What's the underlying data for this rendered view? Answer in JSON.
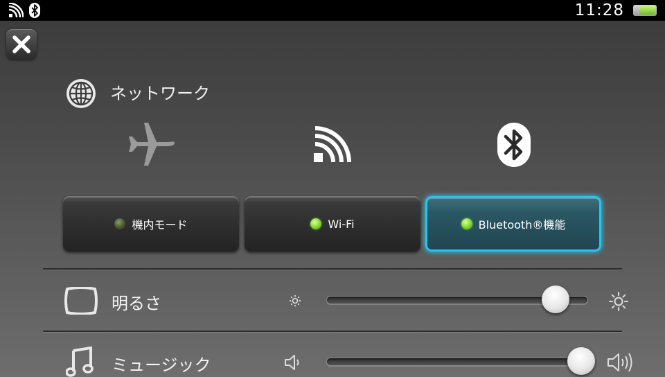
{
  "status_bar": {
    "time": "11:28",
    "battery_level": 0.75,
    "icons": [
      "wifi-icon",
      "bluetooth-icon"
    ]
  },
  "close_button": {
    "icon": "close-icon"
  },
  "network": {
    "title": "ネットワーク",
    "icon": "globe-icon",
    "toggles": [
      {
        "label": "機内モード",
        "icon": "airplane-icon",
        "on": false,
        "active": false
      },
      {
        "label": "Wi-Fi",
        "icon": "wifi-icon",
        "on": true,
        "active": false
      },
      {
        "label": "Bluetooth®機能",
        "icon": "bluetooth-icon",
        "on": true,
        "active": true
      }
    ]
  },
  "brightness": {
    "label": "明るさ",
    "icon": "display-icon",
    "level": 0.88
  },
  "music": {
    "label": "ミュージック",
    "icon": "music-note-icon",
    "level": 0.98
  },
  "colors": {
    "accent": "#22c6f0",
    "led_on": "#8fe03a"
  }
}
